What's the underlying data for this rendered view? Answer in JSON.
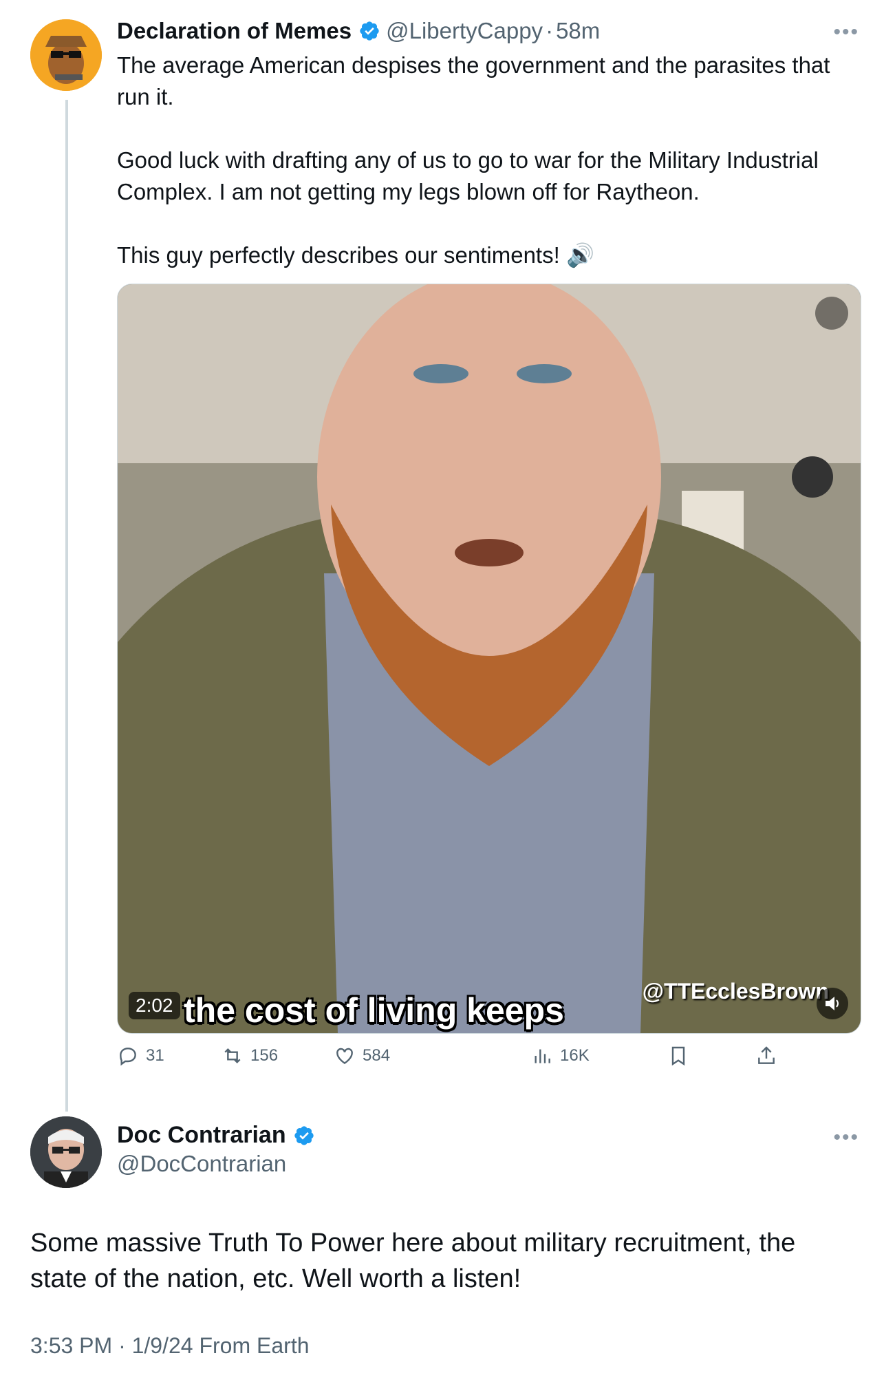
{
  "tweet1": {
    "display_name": "Declaration of Memes",
    "handle": "@LibertyCappy",
    "time": "58m",
    "separator": "·",
    "text_p1": "The average American despises the government and the parasites that run it.",
    "text_p2": "Good luck with drafting any of us to go to war for the Military Industrial Complex. I am not getting my legs blown off for Raytheon.",
    "text_p3": "This guy perfectly describes our sentiments! 🔊",
    "video": {
      "duration": "2:02",
      "caption": "the cost of living keeps",
      "watermark": "@TTEcclesBrown"
    },
    "actions": {
      "replies": "31",
      "reposts": "156",
      "likes": "584",
      "views": "16K"
    }
  },
  "tweet2": {
    "display_name": "Doc Contrarian",
    "handle": "@DocContrarian",
    "text": "Some massive Truth To Power here about military recruitment, the state of the nation, etc. Well worth a listen!",
    "meta": "3:53 PM · 1/9/24 From Earth"
  },
  "icons": {
    "verified": "verified-badge-icon",
    "more": "more-icon",
    "reply": "reply-icon",
    "repost": "repost-icon",
    "like": "heart-icon",
    "views": "views-icon",
    "bookmark": "bookmark-icon",
    "share": "share-icon"
  },
  "colors": {
    "verified_blue": "#1d9bf0",
    "secondary_text": "#536471",
    "primary_text": "#0f1419",
    "thread_line": "#cfd9de"
  }
}
